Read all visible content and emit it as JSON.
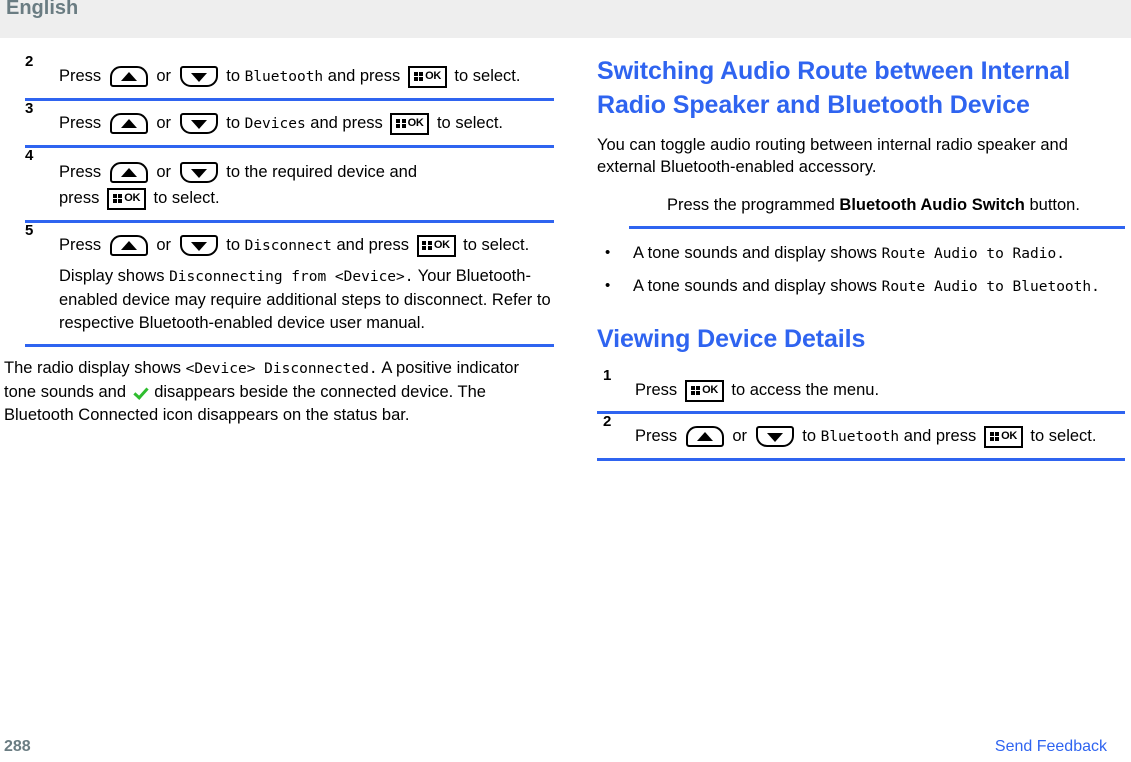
{
  "header": {
    "language_label": "English"
  },
  "left_column": {
    "steps": [
      {
        "number": "2",
        "pre": "Press",
        "mid": "or",
        "to": "to",
        "target": "Bluetooth",
        "and_press": "and press",
        "tail": "to select."
      },
      {
        "number": "3",
        "pre": "Press",
        "mid": "or",
        "to": "to",
        "target": "Devices",
        "and_press": "and press",
        "tail": "to",
        "tail2": "select."
      },
      {
        "number": "4",
        "pre": "Press",
        "mid": "or",
        "to": "to the required device and",
        "second_line_pre": "press",
        "tail": "to select."
      },
      {
        "number": "5",
        "pre": "Press",
        "mid": "or",
        "to": "to",
        "target": "Disconnect",
        "and_press": "and press",
        "tail": "to select.",
        "note_pre": "Display shows",
        "note_mono": "Disconnecting from <Device>.",
        "note_post": "Your Bluetooth-enabled device may require additional steps to disconnect. Refer to respective Bluetooth-enabled device user manual."
      }
    ],
    "closing_paragraph": {
      "pre": "The radio display shows",
      "mono": "<Device> Disconnected.",
      "mid": "A positive indicator tone sounds and",
      "post": "disappears beside the connected device. The Bluetooth Connected icon disappears on the status bar."
    }
  },
  "right_column": {
    "heading_1": "Switching Audio Route between Internal Radio Speaker and Bluetooth Device",
    "intro_paragraph": "You can toggle audio routing between internal radio speaker and external Bluetooth-enabled accessory.",
    "action": {
      "pre": "Press the programmed",
      "bold": "Bluetooth Audio Switch",
      "post": "button."
    },
    "bullets": [
      {
        "text": "A tone sounds and display shows",
        "mono": "Route Audio to Radio."
      },
      {
        "text": "A tone sounds and display shows",
        "mono": "Route Audio to Bluetooth."
      }
    ],
    "heading_2": "Viewing Device Details",
    "steps": [
      {
        "number": "1",
        "pre": "Press",
        "tail": "to access the menu."
      },
      {
        "number": "2",
        "pre": "Press",
        "mid": "or",
        "to": "to",
        "target": "Bluetooth",
        "and_press": "and press",
        "tail": "to select."
      }
    ]
  },
  "footer": {
    "page_number": "288",
    "send_feedback_label": "Send Feedback"
  },
  "icons": {
    "up_key": "arrow-up-key-icon",
    "down_key": "arrow-down-key-icon",
    "ok_key": "menu-ok-key-icon",
    "check": "green-check-icon"
  },
  "colors": {
    "accent_blue": "#2f64f0",
    "header_gray": "#eeeeee",
    "header_text": "#6a7c82",
    "check_green": "#2fbd2f"
  }
}
